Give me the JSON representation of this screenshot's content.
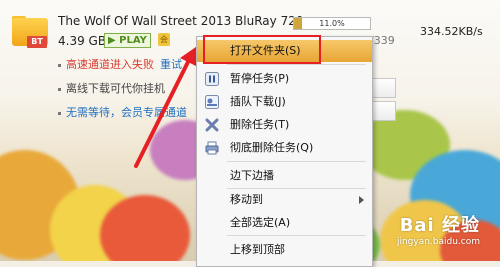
{
  "download": {
    "file_badge": "BT",
    "title": "The Wolf Of Wall Street 2013 BluRay 720...",
    "size": "4.39 GB",
    "play_badge": "PLAY",
    "vip_badge": "会",
    "progress": "11.0%",
    "progress_value": 0.11,
    "count": "/339",
    "speed": "334.52KB/s",
    "status_error": "高速通道进入失败",
    "retry": "重试",
    "offline_hint": "离线下载可代你挂机",
    "member_hint": "无需等待，会员专属通道"
  },
  "context_menu": {
    "items": [
      {
        "label": "打开文件夹(S)",
        "icon": "",
        "highlighted": true
      },
      {
        "label": "暂停任务(P)",
        "icon": "pause-icon"
      },
      {
        "label": "插队下载(J)",
        "icon": "queue-jump-icon"
      },
      {
        "label": "删除任务(T)",
        "icon": "delete-x-icon"
      },
      {
        "label": "彻底删除任务(Q)",
        "icon": "printer-delete-icon"
      },
      {
        "label": "边下边播",
        "icon": ""
      },
      {
        "label": "移动到",
        "icon": "",
        "has_submenu": true
      },
      {
        "label": "全部选定(A)",
        "icon": ""
      },
      {
        "label": "上移到顶部",
        "icon": ""
      }
    ]
  },
  "watermark": {
    "brand": "Bai 经验",
    "url": "jingyan.baidu.com"
  },
  "colors": {
    "highlight_border": "#e51f24",
    "accent_orange": "#e8a534",
    "error_red": "#d83c2f",
    "link_blue": "#1f6fbf"
  }
}
